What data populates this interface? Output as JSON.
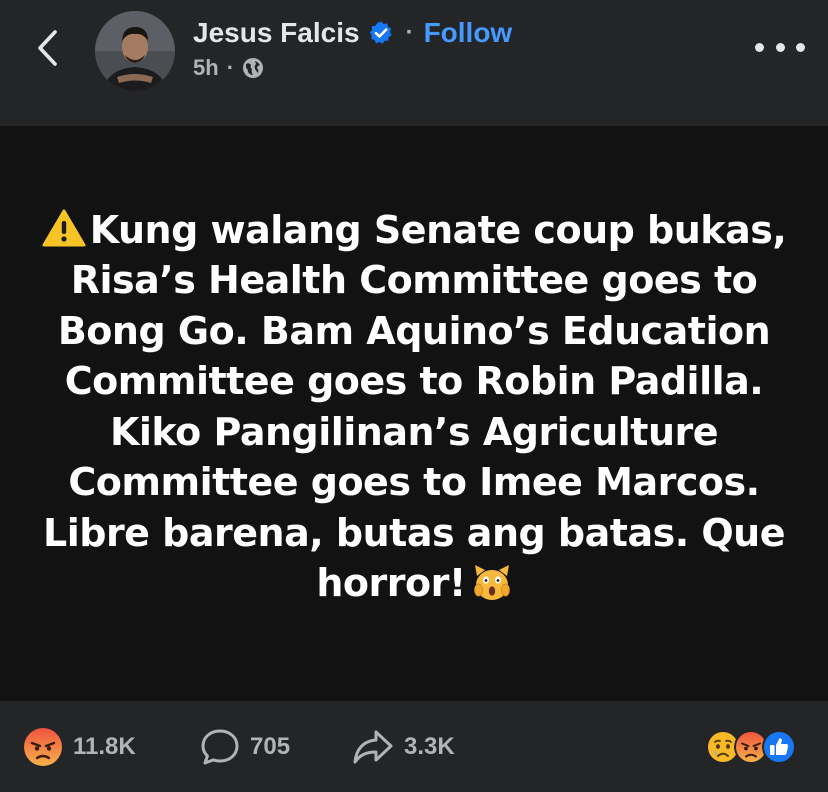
{
  "header": {
    "author_name": "Jesus Falcis",
    "separator": "·",
    "follow_label": "Follow",
    "time": "5h",
    "meta_separator": "·",
    "privacy_icon": "globe-icon",
    "verified_icon": "verified-badge-icon",
    "back_icon": "chevron-left-icon",
    "more_icon": "more-dots-icon"
  },
  "post": {
    "lead_icon": "warning-icon",
    "text": "Kung walang Senate coup bukas, Risa’s Health Committee goes to Bong Go. Bam Aquino’s Education Committee goes to Robin Padilla. Kiko Pangilinan’s Agriculture Committee goes to Imee Marcos. Libre barena, butas ang batas. Que horror!",
    "trail_icon": "screaming-face-icon"
  },
  "footer": {
    "reactions_count": "11.8K",
    "reaction_icon": "angry-react-icon",
    "comments_count": "705",
    "comment_icon": "comment-bubble-icon",
    "shares_count": "3.3K",
    "share_icon": "share-arrow-icon",
    "reaction_cluster": [
      "sad-react-icon",
      "angry-react-icon",
      "like-react-icon"
    ]
  },
  "colors": {
    "header_bg": "#242526",
    "post_bg": "#121212",
    "follow": "#4599ff",
    "verified": "#1877f2",
    "muted": "#b0b3b8"
  }
}
